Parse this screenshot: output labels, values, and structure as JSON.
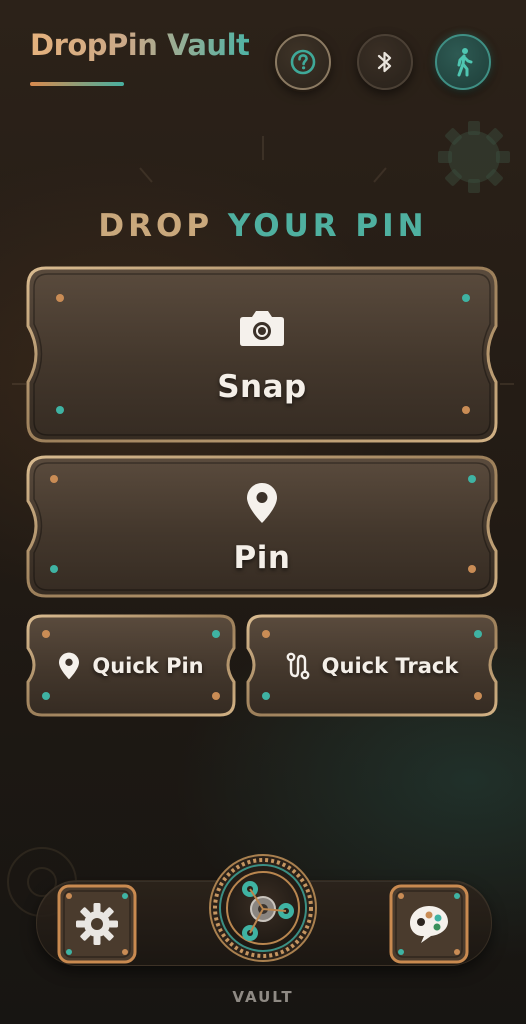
{
  "header": {
    "app_title": "DropPin Vault",
    "help_icon": "help-circle-icon",
    "bluetooth_icon": "bluetooth-icon",
    "walk_icon": "walking-person-icon"
  },
  "heading": {
    "part_a": "DROP",
    "part_b": "YOUR PIN"
  },
  "actions": {
    "snap": {
      "label": "Snap",
      "icon": "camera-icon"
    },
    "pin": {
      "label": "Pin",
      "icon": "map-pin-icon"
    },
    "quick_pin": {
      "label": "Quick Pin",
      "icon": "map-pin-icon"
    },
    "quick_track": {
      "label": "Quick Track",
      "icon": "route-icon"
    }
  },
  "nav": {
    "settings_icon": "gear-icon",
    "vault_icon": "gear-vault-icon",
    "vault_label": "VAULT",
    "palette_icon": "palette-icon"
  },
  "colors": {
    "accent_teal": "#4fb0a0",
    "accent_copper": "#d98a4e",
    "plate_border": "#c9a97f",
    "background": "#241c15"
  }
}
